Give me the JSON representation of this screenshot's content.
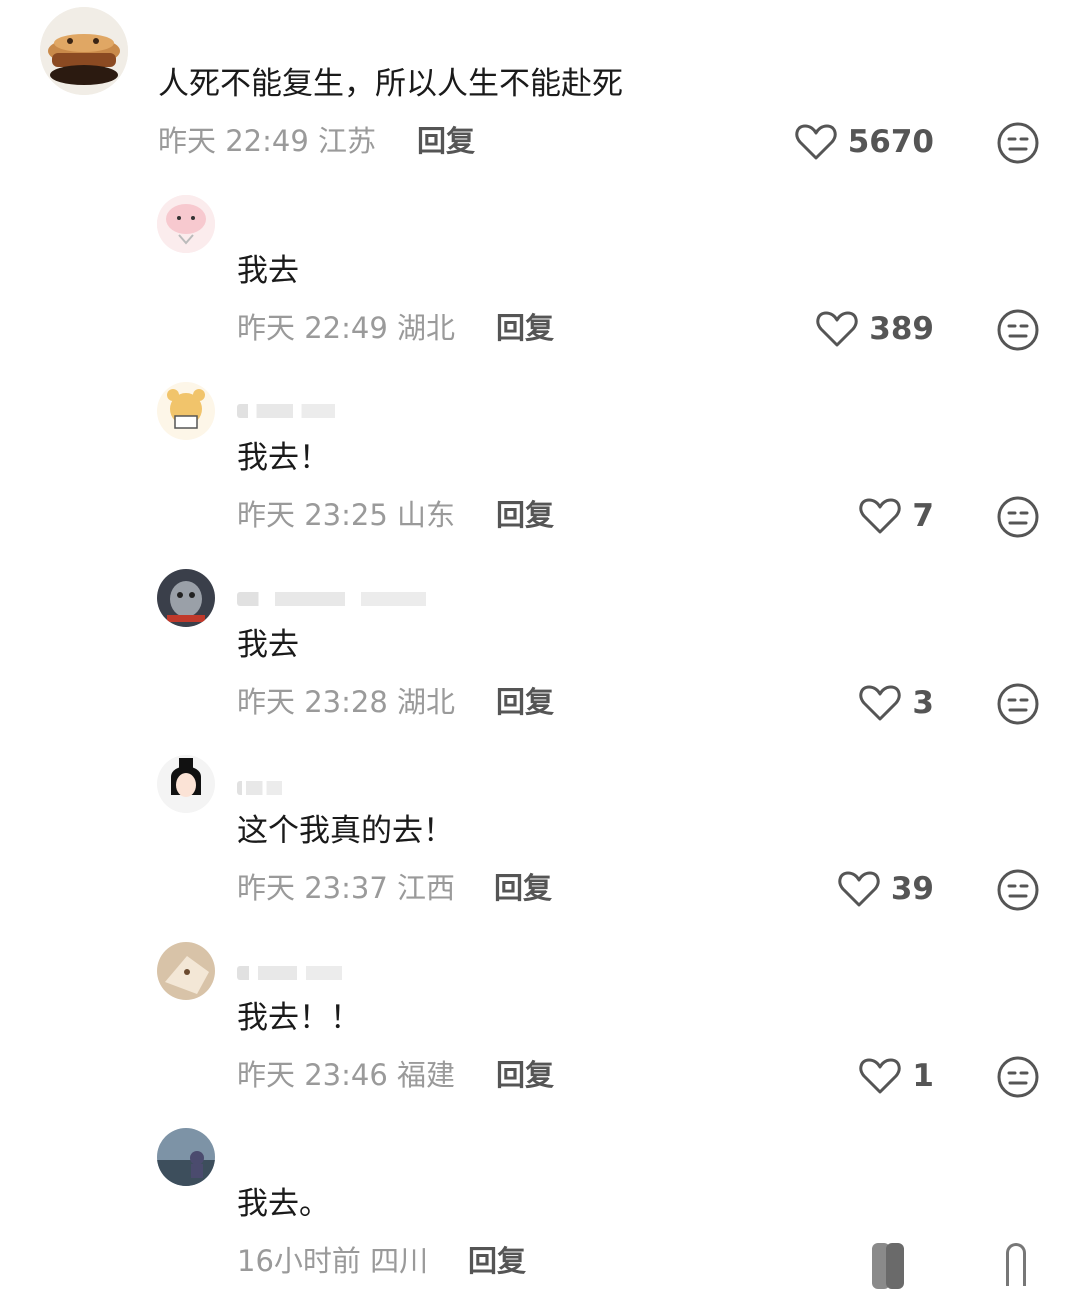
{
  "top_comment": {
    "text": "人死不能复生，所以人生不能赴死",
    "time": "昨天 22:49",
    "location": "江苏",
    "reply_label": "回复",
    "likes": "5670"
  },
  "replies": [
    {
      "text": "我去",
      "time": "昨天 22:49",
      "location": "湖北",
      "reply_label": "回复",
      "likes": "389"
    },
    {
      "text": "我去！",
      "time": "昨天 23:25",
      "location": "山东",
      "reply_label": "回复",
      "likes": "7"
    },
    {
      "text": "我去",
      "time": "昨天 23:28",
      "location": "湖北",
      "reply_label": "回复",
      "likes": "3"
    },
    {
      "text": "这个我真的去！",
      "time": "昨天 23:37",
      "location": "江西",
      "reply_label": "回复",
      "likes": "39"
    },
    {
      "text": "我去！！",
      "time": "昨天 23:46",
      "location": "福建",
      "reply_label": "回复",
      "likes": "1"
    },
    {
      "text": "我去。",
      "time": "16小时前",
      "location": "四川",
      "reply_label": "回复"
    }
  ],
  "icons": {
    "like": "heart-outline-icon",
    "dislike": "neutral-face-icon"
  },
  "colors": {
    "text": "#1a1a1a",
    "meta": "#9a9a9a",
    "icon": "#555555"
  }
}
